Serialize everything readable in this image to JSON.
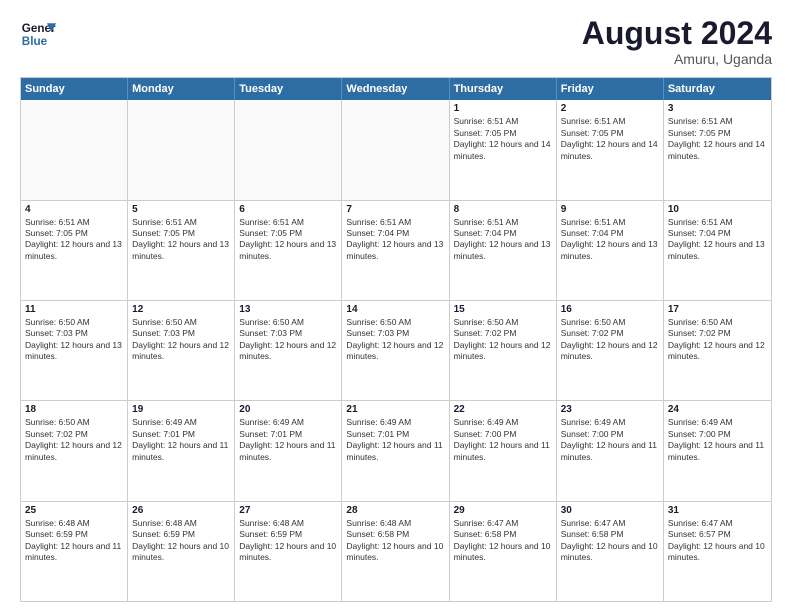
{
  "logo": {
    "line1": "General",
    "line2": "Blue"
  },
  "title": "August 2024",
  "subtitle": "Amuru, Uganda",
  "header_days": [
    "Sunday",
    "Monday",
    "Tuesday",
    "Wednesday",
    "Thursday",
    "Friday",
    "Saturday"
  ],
  "weeks": [
    [
      {
        "day": "",
        "sunrise": "",
        "sunset": "",
        "daylight": ""
      },
      {
        "day": "",
        "sunrise": "",
        "sunset": "",
        "daylight": ""
      },
      {
        "day": "",
        "sunrise": "",
        "sunset": "",
        "daylight": ""
      },
      {
        "day": "",
        "sunrise": "",
        "sunset": "",
        "daylight": ""
      },
      {
        "day": "1",
        "sunrise": "Sunrise: 6:51 AM",
        "sunset": "Sunset: 7:05 PM",
        "daylight": "Daylight: 12 hours and 14 minutes."
      },
      {
        "day": "2",
        "sunrise": "Sunrise: 6:51 AM",
        "sunset": "Sunset: 7:05 PM",
        "daylight": "Daylight: 12 hours and 14 minutes."
      },
      {
        "day": "3",
        "sunrise": "Sunrise: 6:51 AM",
        "sunset": "Sunset: 7:05 PM",
        "daylight": "Daylight: 12 hours and 14 minutes."
      }
    ],
    [
      {
        "day": "4",
        "sunrise": "Sunrise: 6:51 AM",
        "sunset": "Sunset: 7:05 PM",
        "daylight": "Daylight: 12 hours and 13 minutes."
      },
      {
        "day": "5",
        "sunrise": "Sunrise: 6:51 AM",
        "sunset": "Sunset: 7:05 PM",
        "daylight": "Daylight: 12 hours and 13 minutes."
      },
      {
        "day": "6",
        "sunrise": "Sunrise: 6:51 AM",
        "sunset": "Sunset: 7:05 PM",
        "daylight": "Daylight: 12 hours and 13 minutes."
      },
      {
        "day": "7",
        "sunrise": "Sunrise: 6:51 AM",
        "sunset": "Sunset: 7:04 PM",
        "daylight": "Daylight: 12 hours and 13 minutes."
      },
      {
        "day": "8",
        "sunrise": "Sunrise: 6:51 AM",
        "sunset": "Sunset: 7:04 PM",
        "daylight": "Daylight: 12 hours and 13 minutes."
      },
      {
        "day": "9",
        "sunrise": "Sunrise: 6:51 AM",
        "sunset": "Sunset: 7:04 PM",
        "daylight": "Daylight: 12 hours and 13 minutes."
      },
      {
        "day": "10",
        "sunrise": "Sunrise: 6:51 AM",
        "sunset": "Sunset: 7:04 PM",
        "daylight": "Daylight: 12 hours and 13 minutes."
      }
    ],
    [
      {
        "day": "11",
        "sunrise": "Sunrise: 6:50 AM",
        "sunset": "Sunset: 7:03 PM",
        "daylight": "Daylight: 12 hours and 13 minutes."
      },
      {
        "day": "12",
        "sunrise": "Sunrise: 6:50 AM",
        "sunset": "Sunset: 7:03 PM",
        "daylight": "Daylight: 12 hours and 12 minutes."
      },
      {
        "day": "13",
        "sunrise": "Sunrise: 6:50 AM",
        "sunset": "Sunset: 7:03 PM",
        "daylight": "Daylight: 12 hours and 12 minutes."
      },
      {
        "day": "14",
        "sunrise": "Sunrise: 6:50 AM",
        "sunset": "Sunset: 7:03 PM",
        "daylight": "Daylight: 12 hours and 12 minutes."
      },
      {
        "day": "15",
        "sunrise": "Sunrise: 6:50 AM",
        "sunset": "Sunset: 7:02 PM",
        "daylight": "Daylight: 12 hours and 12 minutes."
      },
      {
        "day": "16",
        "sunrise": "Sunrise: 6:50 AM",
        "sunset": "Sunset: 7:02 PM",
        "daylight": "Daylight: 12 hours and 12 minutes."
      },
      {
        "day": "17",
        "sunrise": "Sunrise: 6:50 AM",
        "sunset": "Sunset: 7:02 PM",
        "daylight": "Daylight: 12 hours and 12 minutes."
      }
    ],
    [
      {
        "day": "18",
        "sunrise": "Sunrise: 6:50 AM",
        "sunset": "Sunset: 7:02 PM",
        "daylight": "Daylight: 12 hours and 12 minutes."
      },
      {
        "day": "19",
        "sunrise": "Sunrise: 6:49 AM",
        "sunset": "Sunset: 7:01 PM",
        "daylight": "Daylight: 12 hours and 11 minutes."
      },
      {
        "day": "20",
        "sunrise": "Sunrise: 6:49 AM",
        "sunset": "Sunset: 7:01 PM",
        "daylight": "Daylight: 12 hours and 11 minutes."
      },
      {
        "day": "21",
        "sunrise": "Sunrise: 6:49 AM",
        "sunset": "Sunset: 7:01 PM",
        "daylight": "Daylight: 12 hours and 11 minutes."
      },
      {
        "day": "22",
        "sunrise": "Sunrise: 6:49 AM",
        "sunset": "Sunset: 7:00 PM",
        "daylight": "Daylight: 12 hours and 11 minutes."
      },
      {
        "day": "23",
        "sunrise": "Sunrise: 6:49 AM",
        "sunset": "Sunset: 7:00 PM",
        "daylight": "Daylight: 12 hours and 11 minutes."
      },
      {
        "day": "24",
        "sunrise": "Sunrise: 6:49 AM",
        "sunset": "Sunset: 7:00 PM",
        "daylight": "Daylight: 12 hours and 11 minutes."
      }
    ],
    [
      {
        "day": "25",
        "sunrise": "Sunrise: 6:48 AM",
        "sunset": "Sunset: 6:59 PM",
        "daylight": "Daylight: 12 hours and 11 minutes."
      },
      {
        "day": "26",
        "sunrise": "Sunrise: 6:48 AM",
        "sunset": "Sunset: 6:59 PM",
        "daylight": "Daylight: 12 hours and 10 minutes."
      },
      {
        "day": "27",
        "sunrise": "Sunrise: 6:48 AM",
        "sunset": "Sunset: 6:59 PM",
        "daylight": "Daylight: 12 hours and 10 minutes."
      },
      {
        "day": "28",
        "sunrise": "Sunrise: 6:48 AM",
        "sunset": "Sunset: 6:58 PM",
        "daylight": "Daylight: 12 hours and 10 minutes."
      },
      {
        "day": "29",
        "sunrise": "Sunrise: 6:47 AM",
        "sunset": "Sunset: 6:58 PM",
        "daylight": "Daylight: 12 hours and 10 minutes."
      },
      {
        "day": "30",
        "sunrise": "Sunrise: 6:47 AM",
        "sunset": "Sunset: 6:58 PM",
        "daylight": "Daylight: 12 hours and 10 minutes."
      },
      {
        "day": "31",
        "sunrise": "Sunrise: 6:47 AM",
        "sunset": "Sunset: 6:57 PM",
        "daylight": "Daylight: 12 hours and 10 minutes."
      }
    ]
  ]
}
